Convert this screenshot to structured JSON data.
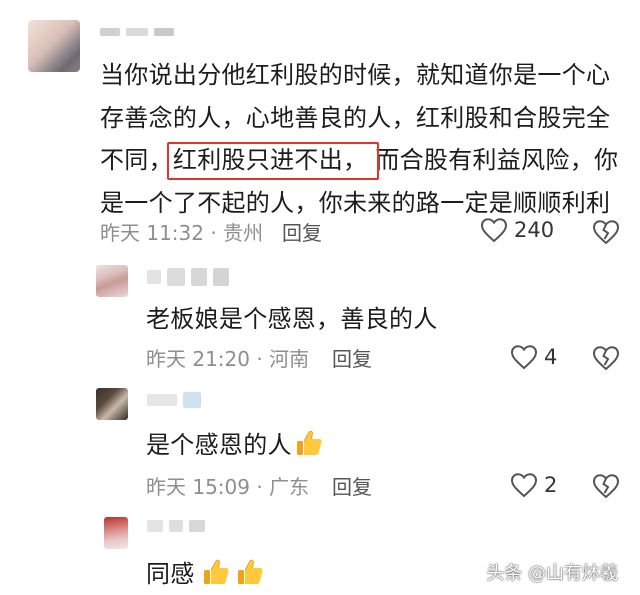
{
  "comments": [
    {
      "text_line1": "当你说出分他红利股的时候，就知道你是一个心",
      "text_line2": "存善念的人，心地善良的人，红利股和合股完全",
      "text_line3_pre": "不同，",
      "text_line3_highlight": "红利股只进不出，",
      "text_line3_post": "而合股有利益风险，你",
      "text_line4": "是一个了不起的人，你未来的路一定是顺顺利利",
      "time_location": "昨天 11:32 · 贵州",
      "reply_label": "回复",
      "like_count": "240"
    }
  ],
  "replies": [
    {
      "text": "老板娘是个感恩，善良的人",
      "time_location": "昨天 21:20 · 河南",
      "reply_label": "回复",
      "like_count": "4"
    },
    {
      "text": "是个感恩的人",
      "time_location": "昨天 15:09 · 广东",
      "reply_label": "回复",
      "like_count": "2"
    },
    {
      "text": "同感"
    }
  ],
  "watermark": "头条 @山有炑羲",
  "colors": {
    "highlight_border": "#e0342d",
    "meta_text": "#8e8e8e",
    "body_text": "#1c1c1c"
  },
  "icons": [
    "heart-outline-icon",
    "broken-heart-icon",
    "thumbs-up-emoji"
  ]
}
